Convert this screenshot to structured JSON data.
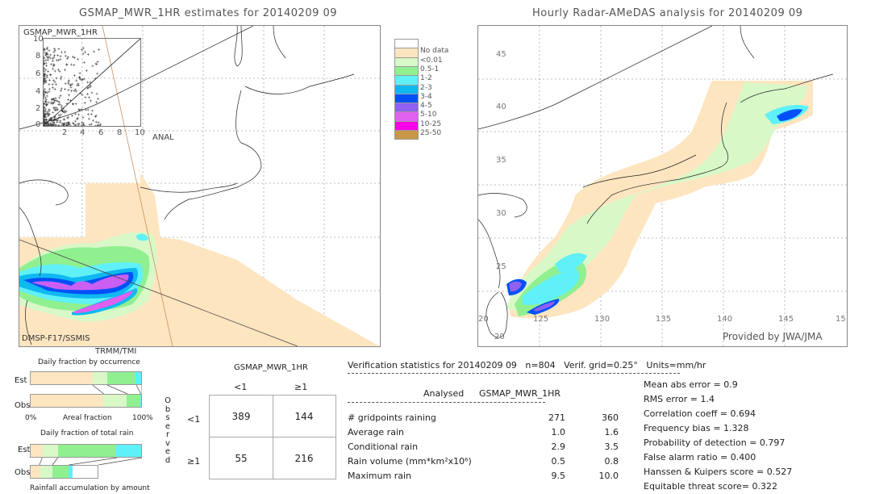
{
  "chart_data": [
    {
      "type": "heatmap",
      "title": "GSMAP_MWR_1HR estimates for 20140209 09",
      "description": "Precipitation map (mm/hr) over Japan region",
      "swath_labels": [
        "DMSP-F17/SSMIS",
        "TRMM/TMI"
      ],
      "inset_scatter": {
        "type": "scatter",
        "title": "GSMAP_MWR_1HR",
        "xlabel": "ANAL",
        "ylabel": "GSMAP_MWR_1HR",
        "xlim": [
          0,
          10
        ],
        "ylim": [
          0,
          10
        ],
        "x_ticks": [
          "2",
          "4",
          "6",
          "8",
          "10"
        ],
        "y_ticks": [
          "0",
          "2",
          "4",
          "6",
          "8",
          "10"
        ],
        "diagonal": true
      }
    },
    {
      "type": "heatmap",
      "title": "Hourly Radar-AMeDAS analysis for 20140209 09",
      "lon_ticks": [
        "125",
        "130",
        "135",
        "140",
        "145",
        "15"
      ],
      "lat_ticks": [
        "45",
        "40",
        "35",
        "30",
        "25",
        "20"
      ],
      "lon_range": [
        120,
        150
      ],
      "lat_range": [
        20,
        50
      ],
      "credit": "Provided by JWA/JMA"
    },
    {
      "type": "bar",
      "title": "Daily fraction by occurrence",
      "xlabel": "Areal fraction",
      "x_min_label": "0%",
      "x_max_label": "100%",
      "categories": [
        "Est",
        "Obs"
      ],
      "series": [
        {
          "name": "No data",
          "values": [
            0.56,
            0.66
          ]
        },
        {
          "name": "<0.01",
          "values": [
            0.13,
            0.21
          ]
        },
        {
          "name": "0.5-1",
          "values": [
            0.26,
            0.12
          ]
        },
        {
          "name": "1-2",
          "values": [
            0.05,
            0.01
          ]
        }
      ]
    },
    {
      "type": "bar",
      "title": "Daily fraction of total rain",
      "xlabel": "Rainfall accumulation by amount",
      "categories": [
        "Est",
        "Obs"
      ],
      "series": [
        {
          "name": "No data",
          "values": [
            0.11,
            0.14
          ]
        },
        {
          "name": "<0.01",
          "values": [
            0.14,
            0.19
          ]
        },
        {
          "name": "0.5-1",
          "values": [
            0.53,
            0.24
          ]
        },
        {
          "name": "1-2",
          "values": [
            0.23,
            0.06
          ]
        }
      ]
    },
    {
      "type": "table",
      "title": "GSMAP_MWR_1HR",
      "row_title": "Observed",
      "col_headers": [
        "<1",
        "≥1"
      ],
      "row_headers": [
        "<1",
        "≥1"
      ],
      "cells": [
        [
          "389",
          "144"
        ],
        [
          "55",
          "216"
        ]
      ]
    }
  ],
  "left_map": {
    "title": "GSMAP_MWR_1HR estimates for 20140209 09",
    "inset_title": "GSMAP_MWR_1HR",
    "inset_xlabel": "ANAL",
    "inset_y_ticks": [
      "10",
      "8",
      "6",
      "4",
      "2",
      "0"
    ],
    "inset_x_ticks": [
      "2",
      "4",
      "6",
      "8",
      "10"
    ],
    "swath1": "DMSP-F17/SSMIS",
    "swath2": "TRMM/TMI"
  },
  "right_map": {
    "title": "Hourly Radar-AMeDAS analysis for 20140209 09",
    "lat_ticks": [
      "45",
      "40",
      "35",
      "30",
      "25"
    ],
    "lon_ticks": [
      "125",
      "130",
      "135",
      "140",
      "145",
      "15"
    ],
    "corner_lat": "20",
    "bottom_lat": "20",
    "credit": "Provided by JWA/JMA"
  },
  "legend": [
    {
      "label": "",
      "color": "#ffffff"
    },
    {
      "label": "No data",
      "color": "#fde5c0"
    },
    {
      "label": "<0.01",
      "color": "#d8f8c8"
    },
    {
      "label": "0.5-1",
      "color": "#90f090"
    },
    {
      "label": "1-2",
      "color": "#60f0f8"
    },
    {
      "label": "2-3",
      "color": "#10b8f0"
    },
    {
      "label": "3-4",
      "color": "#0050f8"
    },
    {
      "label": "4-5",
      "color": "#9060f0"
    },
    {
      "label": "5-10",
      "color": "#e060f0"
    },
    {
      "label": "10-25",
      "color": "#f800e8"
    },
    {
      "label": "25-50",
      "color": "#c89848"
    }
  ],
  "occurrence": {
    "title": "Daily fraction by occurrence",
    "est": "Est",
    "obs": "Obs",
    "left": "0%",
    "mid": "Areal fraction",
    "right": "100%"
  },
  "totalrain": {
    "title": "Daily fraction of total rain",
    "est": "Est",
    "obs": "Obs",
    "xlabel": "Rainfall accumulation by amount"
  },
  "contingency": {
    "title": "GSMAP_MWR_1HR",
    "col1": "<1",
    "col2": "≥1",
    "row1": "<1",
    "row2": "≥1",
    "observed_letters": [
      "O",
      "b",
      "s",
      "e",
      "r",
      "v",
      "e",
      "d"
    ],
    "c11": "389",
    "c12": "144",
    "c21": "55",
    "c22": "216"
  },
  "stats": {
    "header": "Verification statistics for 20140209 09   n=804   Verif. grid=0.25°   Units=mm/hr",
    "col_analysed": "Analysed",
    "col_model": "GSMAP_MWR_1HR",
    "rows": [
      {
        "label": "# gridpoints raining",
        "a": "271",
        "b": "360"
      },
      {
        "label": "Average rain",
        "a": "1.0",
        "b": "1.6"
      },
      {
        "label": "Conditional rain",
        "a": "2.9",
        "b": "3.5"
      },
      {
        "label": "Rain volume (mm*km²x10⁶)",
        "a": "0.5",
        "b": "0.8"
      },
      {
        "label": "Maximum rain",
        "a": "9.5",
        "b": "10.0"
      }
    ],
    "scores": [
      "Mean abs error = 0.9",
      "RMS error = 1.4",
      "Correlation coeff = 0.694",
      "Frequency bias = 1.328",
      "Probability of detection = 0.797",
      "False alarm ratio = 0.400",
      "Hanssen & Kuipers score = 0.527",
      "Equitable threat score= 0.322"
    ]
  }
}
